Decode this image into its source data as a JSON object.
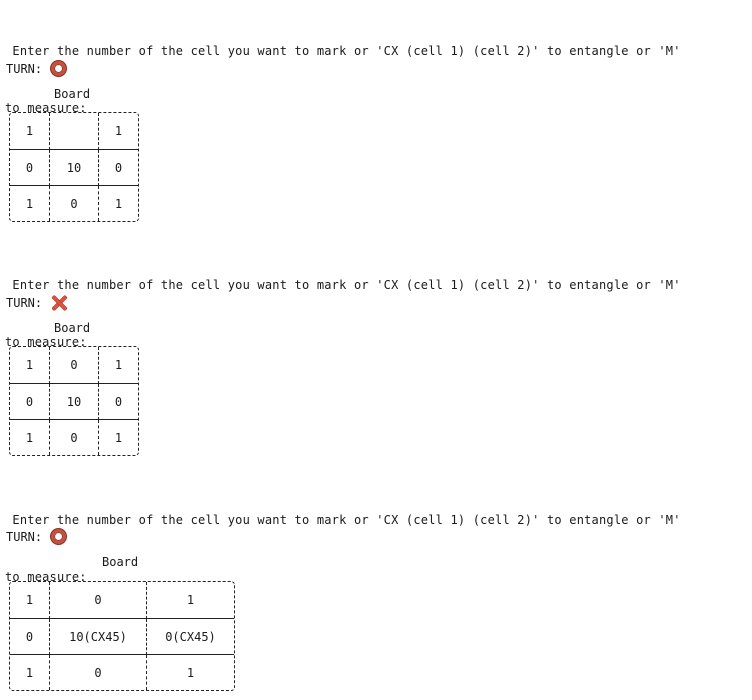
{
  "screens": [
    {
      "prompt_line1": " Enter the number of the cell you want to mark or 'CX (cell 1) (cell 2)' to entangle or 'M'",
      "prompt_line2": "to measure:",
      "turn_label": "TURN:",
      "turn_icon": "circle-o-icon",
      "board_title": "Board",
      "board": [
        [
          "1",
          "",
          "1"
        ],
        [
          "0",
          "10",
          "0"
        ],
        [
          "1",
          "0",
          "1"
        ]
      ]
    },
    {
      "prompt_line1": " Enter the number of the cell you want to mark or 'CX (cell 1) (cell 2)' to entangle or 'M'",
      "prompt_line2": "to measure:",
      "turn_label": "TURN:",
      "turn_icon": "cross-x-icon",
      "board_title": "Board",
      "board": [
        [
          "1",
          "0",
          "1"
        ],
        [
          "0",
          "10",
          "0"
        ],
        [
          "1",
          "0",
          "1"
        ]
      ]
    },
    {
      "prompt_line1": " Enter the number of the cell you want to mark or 'CX (cell 1) (cell 2)' to entangle or 'M'",
      "prompt_line2": "to measure:",
      "turn_label": "TURN:",
      "turn_icon": "circle-o-icon",
      "board_title": "Board",
      "board": [
        [
          "1",
          "0",
          "1"
        ],
        [
          "0",
          "10(CX45)",
          "0(CX45)"
        ],
        [
          "1",
          "0",
          "1"
        ]
      ]
    }
  ],
  "colors": {
    "o_mark": "#c7503f",
    "x_mark": "#e0523c",
    "text": "#1a1a1a"
  }
}
